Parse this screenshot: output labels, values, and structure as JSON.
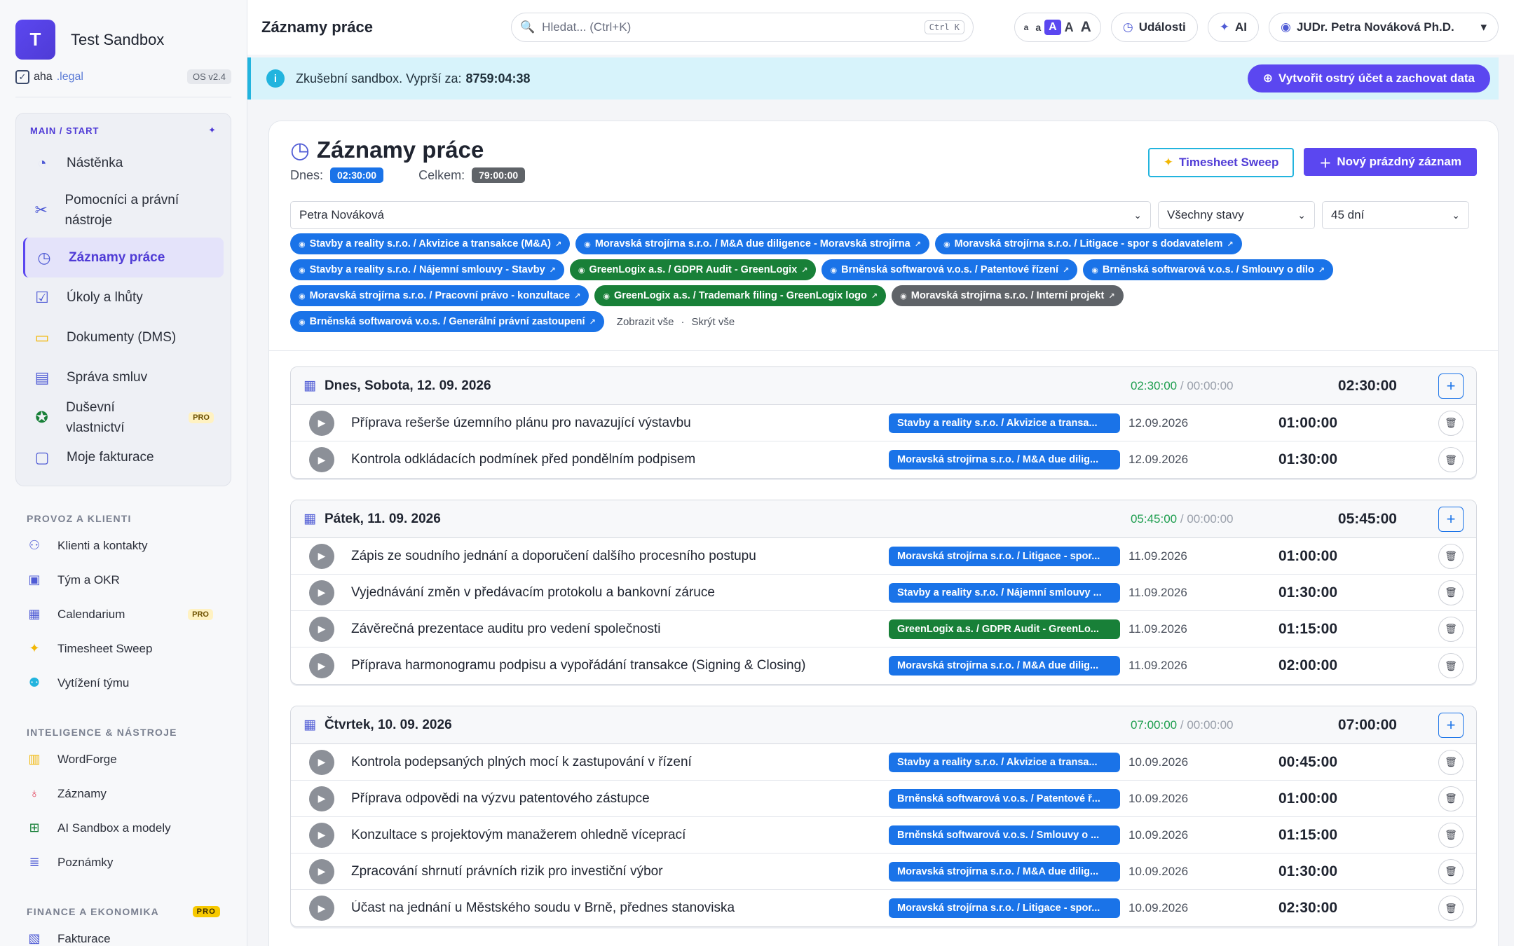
{
  "workspace": {
    "initial": "T",
    "name": "Test Sandbox",
    "brand_a": "aha",
    "brand_b": ".legal",
    "version": "OS v2.4"
  },
  "sidebar": {
    "main_header": "MAIN / START",
    "main_items": [
      {
        "label": "Nástěnka",
        "icon": "dashboard-icon"
      },
      {
        "label": "Pomocníci a právní nástroje",
        "icon": "tools-icon"
      },
      {
        "label": "Záznamy práce",
        "icon": "clock-icon",
        "active": true
      },
      {
        "label": "Úkoly a lhůty",
        "icon": "checkbox-icon"
      },
      {
        "label": "Dokumenty (DMS)",
        "icon": "folder-icon"
      },
      {
        "label": "Správa smluv",
        "icon": "document-icon"
      },
      {
        "label": "Duševní vlastnictví",
        "icon": "award-icon",
        "badge": "PRO"
      },
      {
        "label": "Moje fakturace",
        "icon": "wallet-icon"
      }
    ],
    "groups": [
      {
        "title": "PROVOZ A KLIENTI",
        "items": [
          {
            "label": "Klienti a kontakty",
            "icon": "users-icon"
          },
          {
            "label": "Tým a OKR",
            "icon": "id-card-icon"
          },
          {
            "label": "Calendarium",
            "icon": "calendar-icon",
            "badge": "PRO"
          },
          {
            "label": "Timesheet Sweep",
            "icon": "sparkle-icon"
          },
          {
            "label": "Vytížení týmu",
            "icon": "team-icon"
          }
        ]
      },
      {
        "title": "INTELIGENCE & NÁSTROJE",
        "items": [
          {
            "label": "WordForge",
            "icon": "file-icon"
          },
          {
            "label": "Záznamy",
            "icon": "microphone-icon"
          },
          {
            "label": "AI Sandbox a modely",
            "icon": "chip-icon"
          },
          {
            "label": "Poznámky",
            "icon": "notes-icon"
          }
        ]
      },
      {
        "title": "FINANCE A EKONOMIKA",
        "badge": "PRO",
        "items": [
          {
            "label": "Fakturace",
            "icon": "invoice-icon"
          }
        ]
      }
    ]
  },
  "topbar": {
    "title": "Záznamy práce",
    "search_placeholder": "Hledat... (Ctrl+K)",
    "search_kbd": "Ctrl K",
    "font_sizes": [
      "a",
      "a",
      "A",
      "A",
      "A"
    ],
    "events_label": "Události",
    "ai_label": "AI",
    "user_name": "JUDr. Petra Nováková Ph.D."
  },
  "banner": {
    "text": "Zkušební sandbox. Vyprší za:",
    "time": "8759:04:38",
    "cta": "Vytvořit ostrý účet a zachovat data"
  },
  "page": {
    "title": "Záznamy práce",
    "today_label": "Dnes:",
    "today_value": "02:30:00",
    "total_label": "Celkem:",
    "total_value": "79:00:00",
    "sweep_label": "Timesheet Sweep",
    "new_label": "Nový prázdný záznam"
  },
  "filters": {
    "person": "Petra Nováková",
    "status": "Všechny stavy",
    "range": "45 dní"
  },
  "project_tags": [
    {
      "label": "Stavby a reality s.r.o. / Akvizice a transakce (M&A)",
      "color": "blue"
    },
    {
      "label": "Moravská strojírna s.r.o. / M&A due diligence - Moravská strojírna",
      "color": "blue"
    },
    {
      "label": "Moravská strojírna s.r.o. / Litigace - spor s dodavatelem",
      "color": "blue"
    },
    {
      "label": "Stavby a reality s.r.o. / Nájemní smlouvy - Stavby",
      "color": "blue"
    },
    {
      "label": "GreenLogix a.s. / GDPR Audit - GreenLogix",
      "color": "green"
    },
    {
      "label": "Brněnská softwarová v.o.s. / Patentové řízení",
      "color": "blue"
    },
    {
      "label": "Brněnská softwarová v.o.s. / Smlouvy o dílo",
      "color": "blue"
    },
    {
      "label": "Moravská strojírna s.r.o. / Pracovní právo - konzultace",
      "color": "blue"
    },
    {
      "label": "GreenLogix a.s. / Trademark filing - GreenLogix logo",
      "color": "green"
    },
    {
      "label": "Moravská strojírna s.r.o. / Interní projekt",
      "color": "gray"
    },
    {
      "label": "Brněnská softwarová v.o.s. / Generální právní zastoupení",
      "color": "blue"
    }
  ],
  "tag_links": {
    "show_all": "Zobrazit vše",
    "sep": "·",
    "hide_all": "Skrýt vše"
  },
  "days": [
    {
      "date": "Dnes, Sobota, 12. 09. 2026",
      "logged": "02:30:00",
      "sep": " / ",
      "billed": "00:00:00",
      "total": "02:30:00",
      "entries": [
        {
          "desc": "Příprava rešerše územního plánu pro navazující výstavbu",
          "tag": "Stavby a reality s.r.o. / Akvizice a transa...",
          "color": "blue",
          "date": "12.09.2026",
          "dur": "01:00:00"
        },
        {
          "desc": "Kontrola odkládacích podmínek před pondělním podpisem",
          "tag": "Moravská strojírna s.r.o. / M&A due dilig...",
          "color": "blue",
          "date": "12.09.2026",
          "dur": "01:30:00"
        }
      ]
    },
    {
      "date": "Pátek, 11. 09. 2026",
      "logged": "05:45:00",
      "sep": " / ",
      "billed": "00:00:00",
      "total": "05:45:00",
      "entries": [
        {
          "desc": "Zápis ze soudního jednání a doporučení dalšího procesního postupu",
          "tag": "Moravská strojírna s.r.o. / Litigace - spor...",
          "color": "blue",
          "date": "11.09.2026",
          "dur": "01:00:00"
        },
        {
          "desc": "Vyjednávání změn v předávacím protokolu a bankovní záruce",
          "tag": "Stavby a reality s.r.o. / Nájemní smlouvy ...",
          "color": "blue",
          "date": "11.09.2026",
          "dur": "01:30:00"
        },
        {
          "desc": "Závěrečná prezentace auditu pro vedení společnosti",
          "tag": "GreenLogix a.s. / GDPR Audit - GreenLo...",
          "color": "green",
          "date": "11.09.2026",
          "dur": "01:15:00"
        },
        {
          "desc": "Příprava harmonogramu podpisu a vypořádání transakce (Signing & Closing)",
          "tag": "Moravská strojírna s.r.o. / M&A due dilig...",
          "color": "blue",
          "date": "11.09.2026",
          "dur": "02:00:00"
        }
      ]
    },
    {
      "date": "Čtvrtek, 10. 09. 2026",
      "logged": "07:00:00",
      "sep": " / ",
      "billed": "00:00:00",
      "total": "07:00:00",
      "entries": [
        {
          "desc": "Kontrola podepsaných plných mocí k zastupování v řízení",
          "tag": "Stavby a reality s.r.o. / Akvizice a transa...",
          "color": "blue",
          "date": "10.09.2026",
          "dur": "00:45:00"
        },
        {
          "desc": "Příprava odpovědi na výzvu patentového zástupce",
          "tag": "Brněnská softwarová v.o.s. / Patentové ř...",
          "color": "blue",
          "date": "10.09.2026",
          "dur": "01:00:00"
        },
        {
          "desc": "Konzultace s projektovým manažerem ohledně víceprací",
          "tag": "Brněnská softwarová v.o.s. / Smlouvy o ...",
          "color": "blue",
          "date": "10.09.2026",
          "dur": "01:15:00"
        },
        {
          "desc": "Zpracování shrnutí právních rizik pro investiční výbor",
          "tag": "Moravská strojírna s.r.o. / M&A due dilig...",
          "color": "blue",
          "date": "10.09.2026",
          "dur": "01:30:00"
        },
        {
          "desc": "Účast na jednání u Městského soudu v Brně, přednes stanoviska",
          "tag": "Moravská strojírna s.r.o. / Litigace - spor...",
          "color": "blue",
          "date": "10.09.2026",
          "dur": "02:30:00"
        }
      ]
    }
  ]
}
